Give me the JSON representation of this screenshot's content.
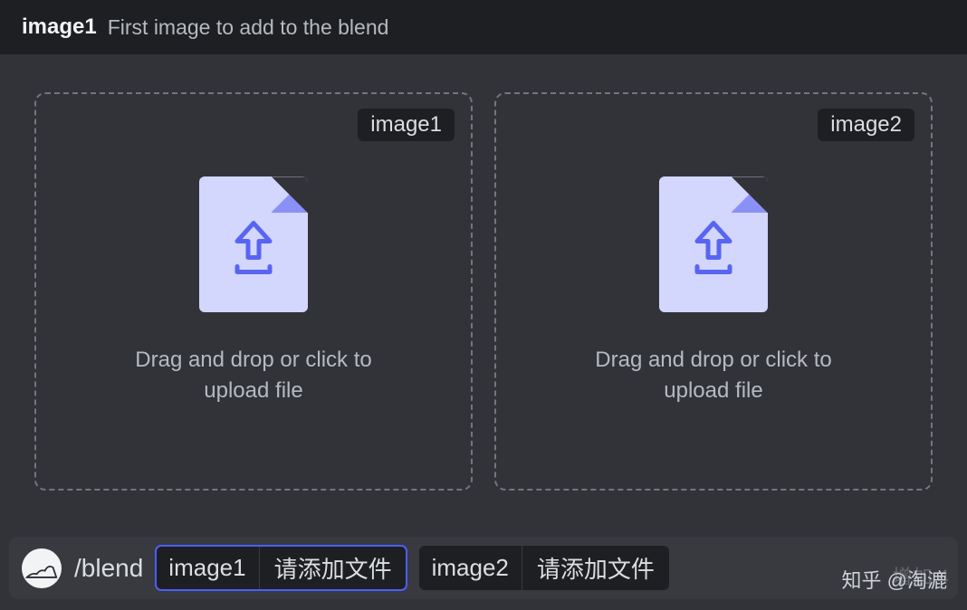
{
  "header": {
    "param": "image1",
    "description": "First image to add to the blend"
  },
  "dropzones": [
    {
      "label": "image1",
      "text": "Drag and drop or click to upload file"
    },
    {
      "label": "image2",
      "text": "Drag and drop or click to upload file"
    }
  ],
  "commandBar": {
    "command": "/blend",
    "params": [
      {
        "name": "image1",
        "value": "请添加文件",
        "active": true
      },
      {
        "name": "image2",
        "value": "请添加文件",
        "active": false
      }
    ]
  },
  "extraHint": "增加 4",
  "watermark": "知乎 @淘漉"
}
